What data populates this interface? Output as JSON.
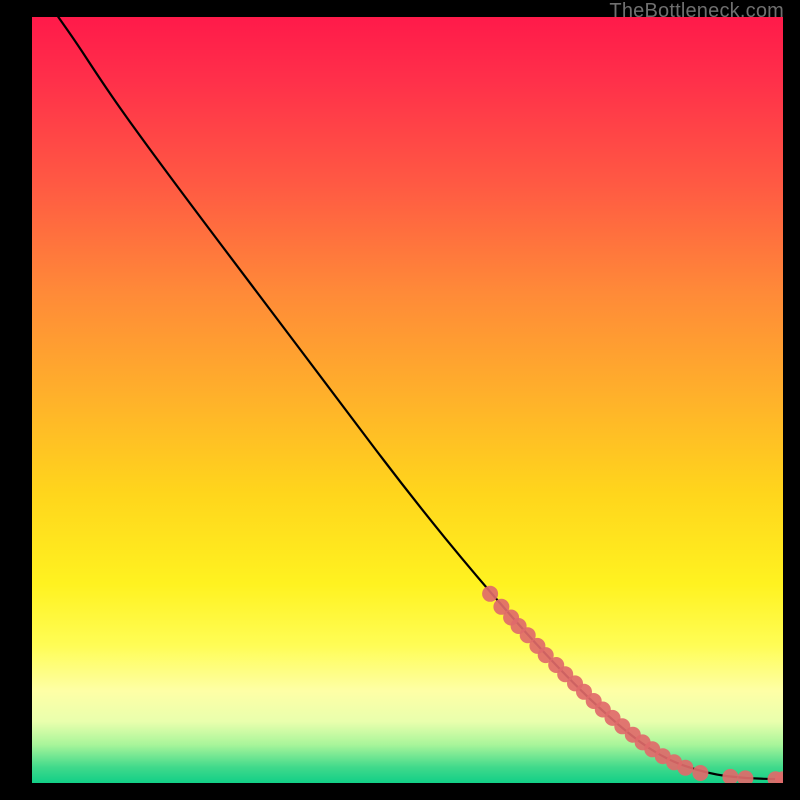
{
  "watermark": "TheBottleneck.com",
  "chart_data": {
    "type": "line",
    "title": "",
    "xlabel": "",
    "ylabel": "",
    "xlim": [
      0,
      100
    ],
    "ylim": [
      0,
      100
    ],
    "series": [
      {
        "name": "curve",
        "points": [
          {
            "x": 3.5,
            "y": 100.0
          },
          {
            "x": 6.0,
            "y": 96.5
          },
          {
            "x": 9.0,
            "y": 92.0
          },
          {
            "x": 12.5,
            "y": 87.0
          },
          {
            "x": 20.0,
            "y": 77.0
          },
          {
            "x": 30.0,
            "y": 64.0
          },
          {
            "x": 40.0,
            "y": 51.0
          },
          {
            "x": 50.0,
            "y": 38.0
          },
          {
            "x": 60.0,
            "y": 26.0
          },
          {
            "x": 70.0,
            "y": 15.0
          },
          {
            "x": 78.0,
            "y": 7.5
          },
          {
            "x": 84.0,
            "y": 3.2
          },
          {
            "x": 90.0,
            "y": 1.2
          },
          {
            "x": 95.0,
            "y": 0.6
          },
          {
            "x": 100.0,
            "y": 0.5
          }
        ]
      }
    ],
    "scatter": {
      "name": "dots",
      "color": "#e06a6a",
      "points": [
        {
          "x": 61.0,
          "y": 24.7
        },
        {
          "x": 62.5,
          "y": 23.0
        },
        {
          "x": 63.8,
          "y": 21.6
        },
        {
          "x": 64.8,
          "y": 20.5
        },
        {
          "x": 66.0,
          "y": 19.3
        },
        {
          "x": 67.3,
          "y": 17.9
        },
        {
          "x": 68.4,
          "y": 16.7
        },
        {
          "x": 69.8,
          "y": 15.4
        },
        {
          "x": 71.0,
          "y": 14.2
        },
        {
          "x": 72.3,
          "y": 13.0
        },
        {
          "x": 73.5,
          "y": 11.9
        },
        {
          "x": 74.8,
          "y": 10.7
        },
        {
          "x": 76.0,
          "y": 9.6
        },
        {
          "x": 77.3,
          "y": 8.5
        },
        {
          "x": 78.6,
          "y": 7.4
        },
        {
          "x": 80.0,
          "y": 6.3
        },
        {
          "x": 81.3,
          "y": 5.3
        },
        {
          "x": 82.6,
          "y": 4.4
        },
        {
          "x": 84.0,
          "y": 3.5
        },
        {
          "x": 85.5,
          "y": 2.7
        },
        {
          "x": 87.0,
          "y": 2.0
        },
        {
          "x": 89.0,
          "y": 1.3
        },
        {
          "x": 93.0,
          "y": 0.8
        },
        {
          "x": 95.0,
          "y": 0.6
        },
        {
          "x": 99.0,
          "y": 0.5
        },
        {
          "x": 100.0,
          "y": 0.5
        }
      ]
    },
    "gradient_stops": [
      {
        "pos": 0,
        "color": "#ff1a4a"
      },
      {
        "pos": 22,
        "color": "#ff5a43"
      },
      {
        "pos": 50,
        "color": "#ffb22a"
      },
      {
        "pos": 74,
        "color": "#fff220"
      },
      {
        "pos": 92,
        "color": "#e9ffad"
      },
      {
        "pos": 100,
        "color": "#12cf87"
      }
    ]
  }
}
